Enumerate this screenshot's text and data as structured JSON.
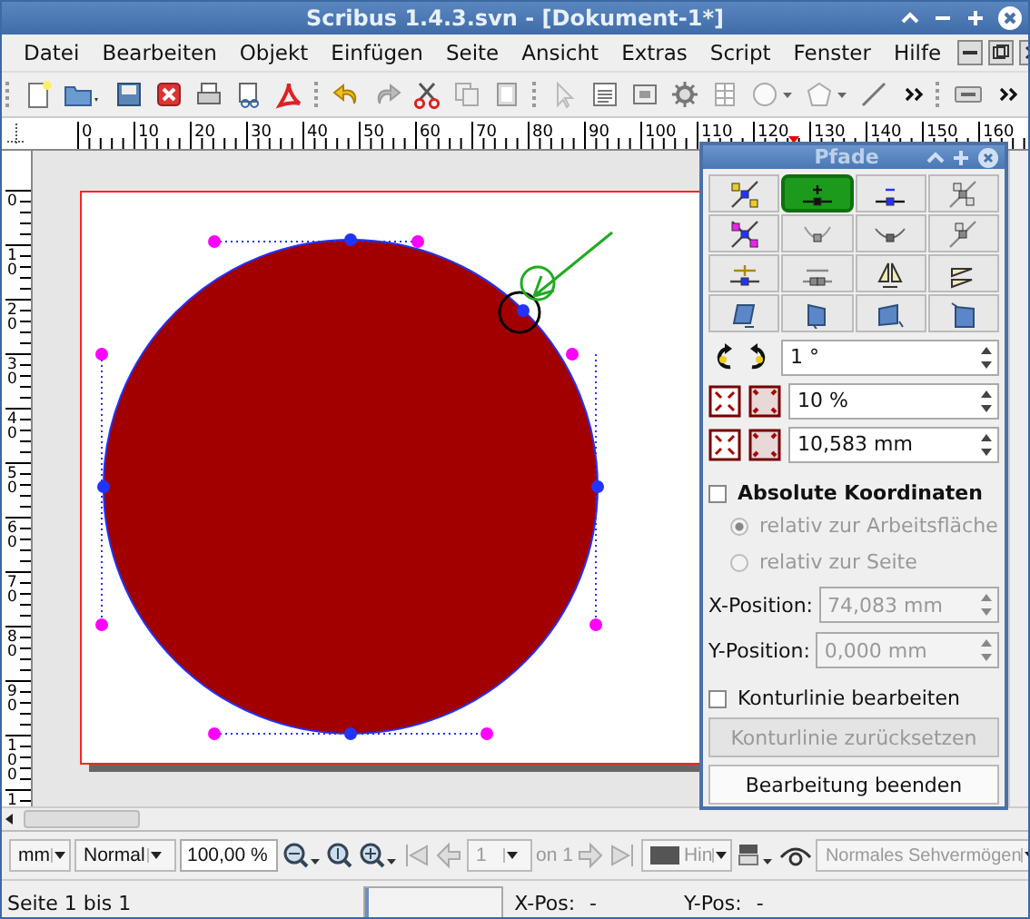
{
  "window": {
    "title": "Scribus 1.4.3.svn - [Dokument-1*]"
  },
  "menu": [
    "Datei",
    "Bearbeiten",
    "Objekt",
    "Einfügen",
    "Seite",
    "Ansicht",
    "Extras",
    "Script",
    "Fenster",
    "Hilfe"
  ],
  "rulers": {
    "horizontal": [
      "0",
      "10",
      "20",
      "30",
      "40",
      "50",
      "60",
      "70",
      "80",
      "90",
      "100",
      "110",
      "120",
      "130",
      "140",
      "150",
      "160"
    ],
    "vertical": [
      "0",
      "10",
      "20",
      "30",
      "40",
      "50",
      "60",
      "70",
      "80",
      "90",
      "100",
      "1"
    ]
  },
  "palette": {
    "title": "Pfade",
    "tools": [
      {
        "selected": false
      },
      {
        "selected": true
      },
      {
        "selected": false
      },
      {
        "selected": false
      },
      {
        "selected": false
      },
      {
        "selected": false
      },
      {
        "selected": false
      },
      {
        "selected": false
      },
      {
        "selected": false
      },
      {
        "selected": false
      },
      {
        "selected": false
      },
      {
        "selected": false
      },
      {
        "selected": false
      },
      {
        "selected": false
      },
      {
        "selected": false
      },
      {
        "selected": false
      }
    ],
    "rotation": "1 °",
    "scale_percent": "10 %",
    "scale_length": "10,583 mm",
    "absolute": {
      "label": "Absolute Koordinaten",
      "checked": false
    },
    "reference": [
      {
        "label": "relativ zur Arbeitsfläche",
        "selected": true,
        "disabled": true
      },
      {
        "label": "relativ zur Seite",
        "selected": false,
        "disabled": true
      }
    ],
    "x_position": {
      "label": "X-Position:",
      "value": "74,083 mm",
      "disabled": true
    },
    "y_position": {
      "label": "Y-Position:",
      "value": "0,000 mm",
      "disabled": true
    },
    "edit_contour": {
      "label": "Konturlinie bearbeiten",
      "checked": false
    },
    "buttons": [
      {
        "label": "Konturlinie zurücksetzen",
        "disabled": true
      },
      {
        "label": "Bearbeitung beenden",
        "disabled": false
      }
    ]
  },
  "bottom_bar": {
    "unit": "mm",
    "mode": "Normal",
    "zoom": "100,00 %",
    "page": "1",
    "page_count": "on 1",
    "fill_name": "Hin",
    "vision": "Normales Sehvermögen"
  },
  "status_bar": {
    "page": "Seite 1 bis 1",
    "progress": {
      "level": 0.03
    },
    "x_label": "X-Pos:",
    "x_value": "-",
    "y_label": "Y-Pos:",
    "y_value": "-"
  }
}
